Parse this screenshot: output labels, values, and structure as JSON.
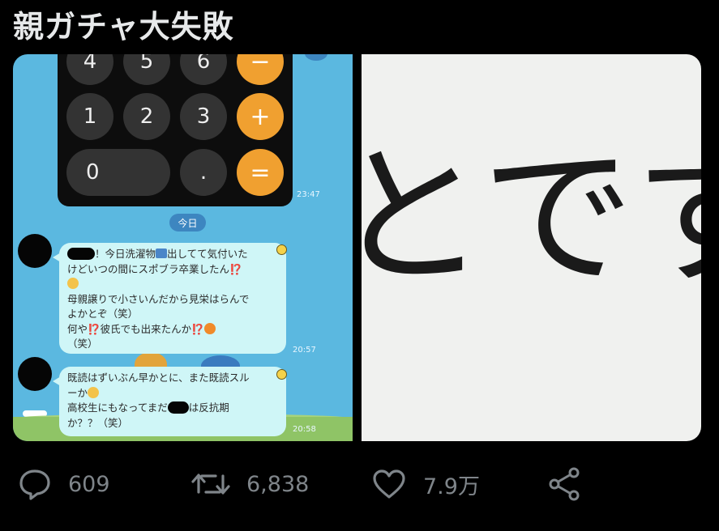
{
  "post": {
    "title": "親ガチャ大失敗"
  },
  "chat": {
    "calc_keys": [
      {
        "label": "4"
      },
      {
        "label": "5"
      },
      {
        "label": "6"
      },
      {
        "label": "−"
      },
      {
        "label": "1"
      },
      {
        "label": "2"
      },
      {
        "label": "3"
      },
      {
        "label": "+"
      },
      {
        "label": "0"
      },
      {
        "label": "."
      },
      {
        "label": "="
      }
    ],
    "calc_time": "23:47",
    "date_divider": "今日",
    "message1": {
      "line1a": "！今日洗濯物",
      "line1b": "出してて気付いた",
      "line2": "けどいつの間にスポブラ卒業したん",
      "line2_mark": "⁉️",
      "line4": "母親譲りで小さいんだから見栄はらんで",
      "line5": "よかとぞ（笑）",
      "line6a": "何や",
      "line6_mark": "⁉️",
      "line6b": "彼氏でも出来たんか",
      "line6_mark2": "⁉️",
      "line7": "（笑）",
      "time": "20:57"
    },
    "message2": {
      "line1": "既読はずいぶん早かとに、また既読スル",
      "line2": "ーか",
      "line3a": "高校生にもなってまだ",
      "line3b": "は反抗期",
      "line4": "か？？（笑）",
      "time": "20:58"
    }
  },
  "zoom_image": {
    "text": "とです"
  },
  "actions": {
    "replies": "609",
    "retweets": "6,838",
    "likes": "7.9万",
    "icons": [
      "reply-icon",
      "retweet-icon",
      "like-icon",
      "share-icon"
    ]
  }
}
